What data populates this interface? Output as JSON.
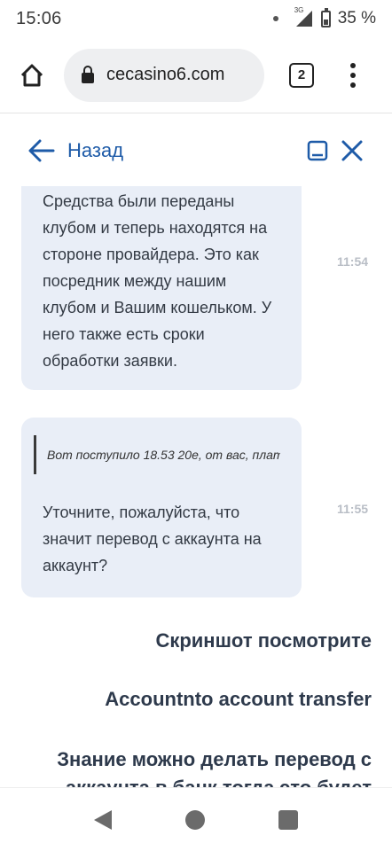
{
  "status_bar": {
    "time": "15:06",
    "network": "3G",
    "battery": "35 %"
  },
  "browser": {
    "url": "cecasino6.com",
    "tab_count": "2"
  },
  "chat_header": {
    "back_label": "Назад"
  },
  "messages": [
    {
      "text_lines": [
        "Средства были переданы",
        "клубом и теперь находятся на",
        "стороне провайдера. Это как",
        "посредник между нашим",
        "клубом и Вашим кошельком. У",
        "него также есть сроки",
        "обработки заявки."
      ],
      "time": "11:54"
    },
    {
      "quote": "Вот поступило 18.53 20е, от вас, плат...",
      "text_lines": [
        "Уточните, пожалуйста, что",
        "значит перевод с аккаунта на",
        "аккаунт?"
      ],
      "time": "11:55"
    }
  ],
  "user_messages": [
    "Скриншот посмотрите",
    "Accountnto account transfer",
    "Знание можно делать перевод с",
    "аккаунта в банк тогда это будет"
  ],
  "colors": {
    "accent": "#1e5ba8",
    "bubble": "#e9eef7",
    "time": "#b9bec6"
  }
}
